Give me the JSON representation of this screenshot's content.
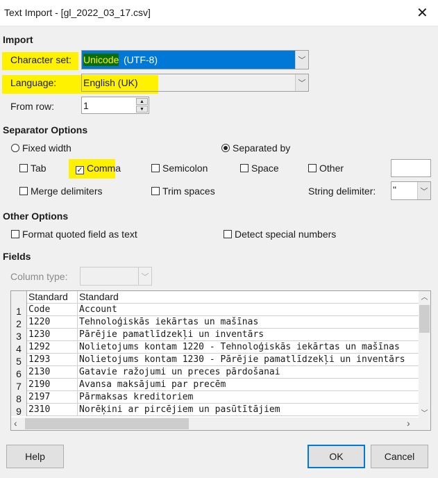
{
  "window": {
    "title": "Text Import - [gl_2022_03_17.csv]",
    "close_icon": "close-icon"
  },
  "import": {
    "heading": "Import",
    "charset_label": "Character set:",
    "charset_value_highlight": "Unicode",
    "charset_value_rest": " (UTF-8)",
    "language_label": "Language:",
    "language_value": "English (UK)",
    "from_row_label": "From row:",
    "from_row_value": "1"
  },
  "separator": {
    "heading": "Separator Options",
    "fixed_width": "Fixed width",
    "separated_by": "Separated by",
    "mode": "separated_by",
    "tab": "Tab",
    "comma": "Comma",
    "semicolon": "Semicolon",
    "space": "Space",
    "other": "Other",
    "other_value": "",
    "merge": "Merge delimiters",
    "trim": "Trim spaces",
    "string_delim_label": "String delimiter:",
    "string_delim_value": "\"",
    "checked": {
      "tab": false,
      "comma": true,
      "semicolon": false,
      "space": false,
      "other": false,
      "merge": false,
      "trim": false
    }
  },
  "other_options": {
    "heading": "Other Options",
    "format_quoted": "Format quoted field as text",
    "detect_special": "Detect special numbers"
  },
  "fields": {
    "heading": "Fields",
    "column_type_label": "Column type:",
    "column_type_value": "",
    "headers": [
      "Standard",
      "Standard"
    ],
    "rows": [
      [
        "1",
        "Code",
        "Account"
      ],
      [
        "2",
        "1220",
        "Tehnoloģiskās iekārtas un mašīnas"
      ],
      [
        "3",
        "1230",
        "Pārējie pamatlīdzekļi un inventārs"
      ],
      [
        "4",
        "1292",
        "Nolietojums kontam 1220 - Tehnoloģiskās iekārtas un mašīnas"
      ],
      [
        "5",
        "1293",
        "Nolietojums kontam 1230 - Pārējie pamatlīdzekļi un inventārs"
      ],
      [
        "6",
        "2130",
        "Gatavie ražojumi un preces pārdošanai"
      ],
      [
        "7",
        "2190",
        "Avansa maksājumi par precēm"
      ],
      [
        "8",
        "2197",
        "Pārmaksas kreditoriem"
      ],
      [
        "9",
        "2310",
        "Norēķini ar pircējiem un pasūtītājiem"
      ]
    ]
  },
  "buttons": {
    "help": "Help",
    "ok": "OK",
    "cancel": "Cancel"
  },
  "colors": {
    "highlight": "#fff200",
    "selection": "#0078d7"
  }
}
